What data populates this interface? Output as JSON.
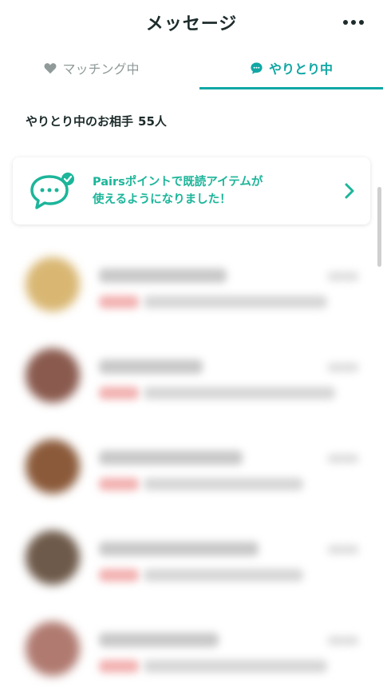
{
  "header": {
    "title": "メッセージ",
    "more_icon": "more-horizontal-icon"
  },
  "tabs": [
    {
      "label": "マッチング中",
      "icon": "heart-icon",
      "active": false
    },
    {
      "label": "やりとり中",
      "icon": "chat-bubble-icon",
      "active": true
    }
  ],
  "count": {
    "label": "やりとり中のお相手",
    "value": "55人"
  },
  "banner": {
    "line1": "Pairsポイントで既読アイテムが",
    "line2": "使えるようになりました！",
    "icon": "chat-check-icon",
    "chevron_icon": "chevron-right-icon"
  },
  "conversations": [
    {
      "avatar_color": "#d9b773"
    },
    {
      "avatar_color": "#8a5a4e"
    },
    {
      "avatar_color": "#8b5a3a"
    },
    {
      "avatar_color": "#6e5a4a"
    },
    {
      "avatar_color": "#b07a70"
    }
  ],
  "colors": {
    "accent": "#10a7a4",
    "banner_text": "#1cb59a",
    "inactive": "#8f9a99"
  }
}
